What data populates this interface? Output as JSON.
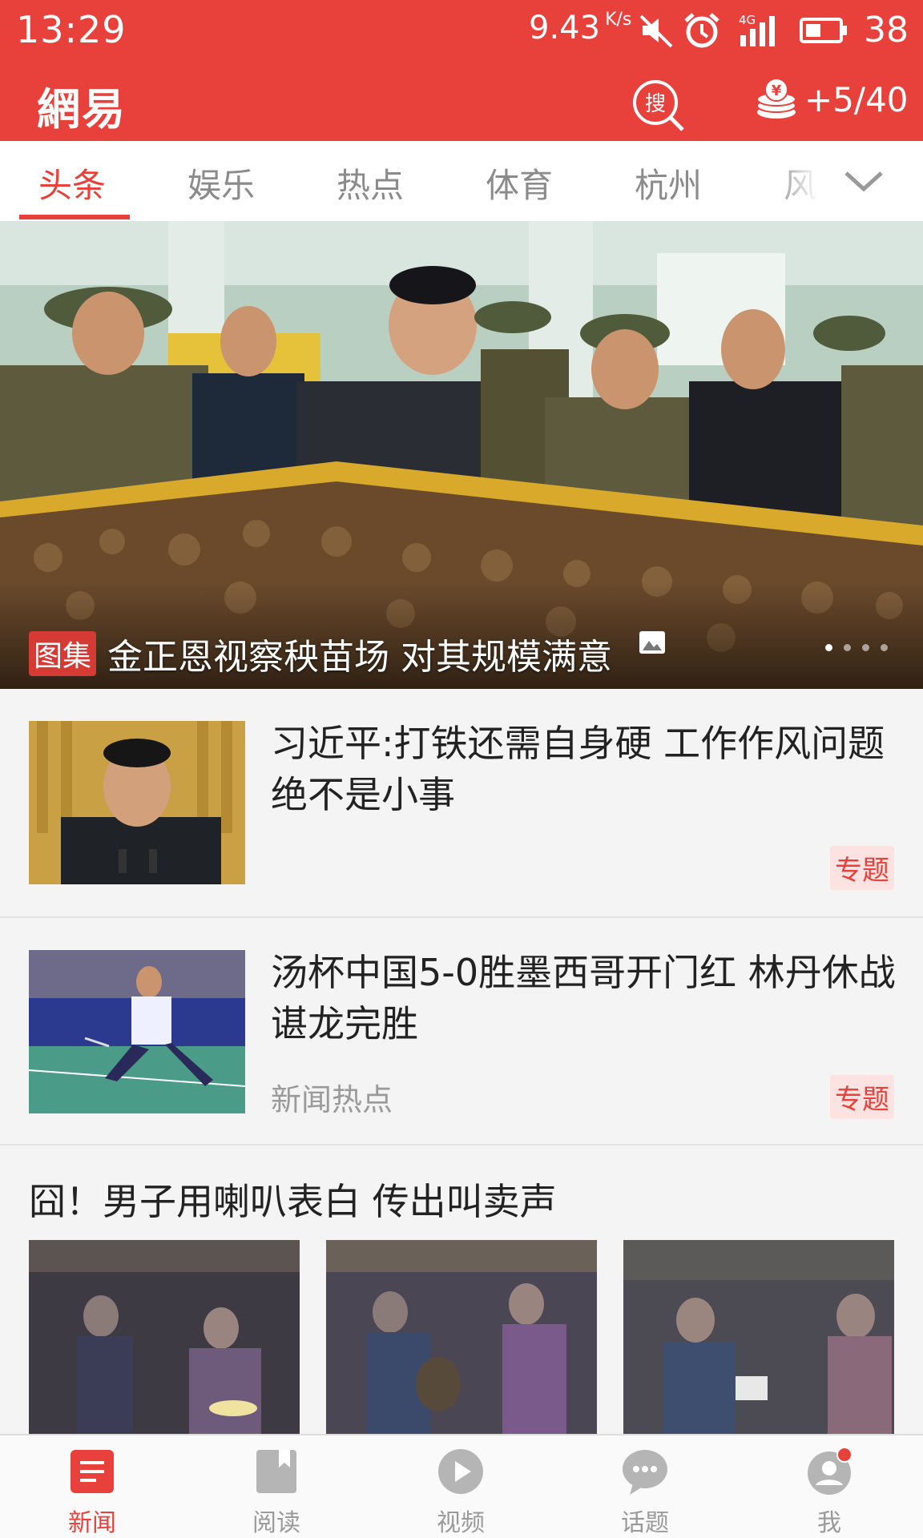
{
  "status_bar": {
    "time": "13:29",
    "speed": "9.43",
    "speed_unit": "K/s",
    "network": "4G",
    "battery": "38"
  },
  "header": {
    "logo": "網易",
    "search_label": "搜",
    "coins": "+5/40",
    "accent_color": "#e8413b"
  },
  "tabs": [
    {
      "label": "头条",
      "active": true
    },
    {
      "label": "娱乐"
    },
    {
      "label": "热点"
    },
    {
      "label": "体育"
    },
    {
      "label": "杭州"
    },
    {
      "label": "风"
    }
  ],
  "hero": {
    "badge": "图集",
    "title": "金正恩视察秧苗场 对其规模满意",
    "slide_count": 4,
    "active_slide": 1
  },
  "news": [
    {
      "title": "习近平:打铁还需自身硬 工作作风问题绝不是小事",
      "source": "",
      "tag": "专题"
    },
    {
      "title": "汤杯中国5-0胜墨西哥开门红 林丹休战谌龙完胜",
      "source": "新闻热点",
      "tag": "专题"
    }
  ],
  "photoset": {
    "title": "囧！男子用喇叭表白 传出叫卖声"
  },
  "bottom_nav": [
    {
      "label": "新闻",
      "icon": "news-icon",
      "active": true
    },
    {
      "label": "阅读",
      "icon": "book-icon"
    },
    {
      "label": "视频",
      "icon": "play-icon"
    },
    {
      "label": "话题",
      "icon": "chat-icon"
    },
    {
      "label": "我",
      "icon": "profile-icon",
      "badge_dot": true
    }
  ]
}
